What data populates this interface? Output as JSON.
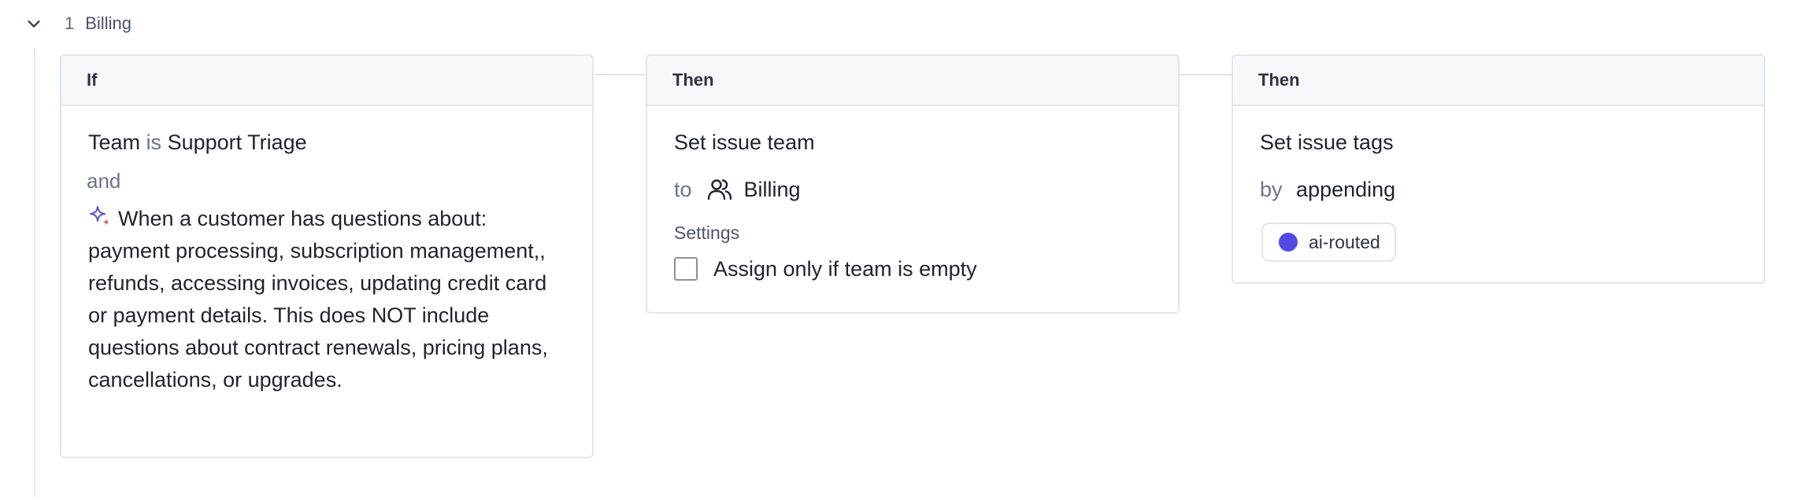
{
  "rule": {
    "number": "1",
    "name": "Billing"
  },
  "if_card": {
    "header": "If",
    "condition": {
      "field": "Team",
      "operator": "is",
      "value": "Support Triage"
    },
    "conjunction": "and",
    "ai_icon": "sparkle-icon",
    "ai_text": "When a customer has questions about: payment processing, subscription management,, refunds, accessing invoices, updating credit card or payment details. This does NOT include questions about contract renewals, pricing plans, cancellations, or upgrades."
  },
  "then_team": {
    "header": "Then",
    "title": "Set issue team",
    "to_label": "to",
    "team_icon": "users-icon",
    "team": "Billing",
    "settings_label": "Settings",
    "checkbox_label": "Assign only if team is empty",
    "checkbox_checked": false
  },
  "then_tags": {
    "header": "Then",
    "title": "Set issue tags",
    "by_label": "by",
    "mode": "appending",
    "tag": {
      "label": "ai-routed",
      "color": "#5548e6"
    }
  }
}
